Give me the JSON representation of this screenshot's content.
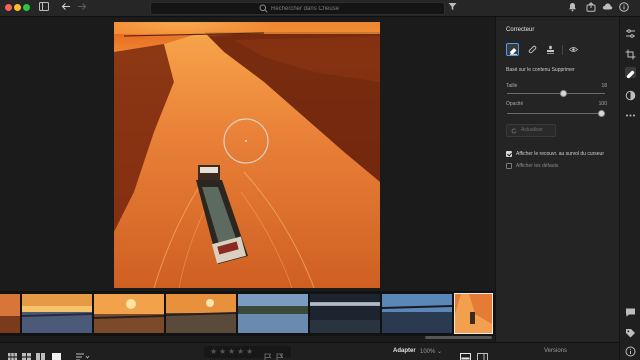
{
  "window": {
    "traffic_lights": [
      "close",
      "minimize",
      "zoom"
    ]
  },
  "toolbar": {
    "search_placeholder": "Rechercher dans Cheuse",
    "icons": [
      "sidebar-toggle-icon",
      "back-arrow-icon",
      "forward-arrow-icon",
      "filter-icon",
      "bell-icon",
      "share-icon",
      "cloud-icon",
      "help-icon"
    ]
  },
  "panel": {
    "title": "Correcteur",
    "mode_label": "Basé sur le contenu  Supprimer",
    "size": {
      "label": "Taille",
      "value": "18",
      "fraction": 0.58
    },
    "opacity": {
      "label": "Opacité",
      "value": "100",
      "fraction": 1.0
    },
    "refresh_label": "Actualiser",
    "checkbox_overlay": {
      "label": "Afficher le recouvr. au survol du curseur",
      "checked": true
    },
    "checkbox_defects": {
      "label": "Afficher les défauts",
      "checked": false
    }
  },
  "bottombar": {
    "fit_label": "Adapter",
    "zoom_value": "100% ⌄",
    "versions_label": "Versions",
    "rating_stars": 5,
    "colors": {
      "accent": "#4a9ef7"
    }
  },
  "filmstrip": {
    "count": 8,
    "selected_index": 7
  }
}
